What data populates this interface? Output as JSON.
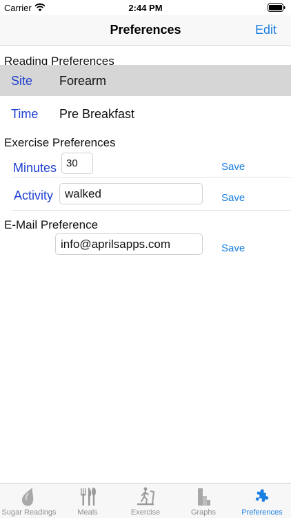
{
  "status_bar": {
    "carrier": "Carrier",
    "time": "2:44 PM",
    "wifi_icon": "wifi-icon",
    "battery_icon": "battery-icon"
  },
  "nav_bar": {
    "title": "Preferences",
    "edit_label": "Edit"
  },
  "reading_preferences": {
    "header": "Reading Preferences",
    "site_label": "Site",
    "site_value": "Forearm",
    "time_label": "Time",
    "time_value": "Pre Breakfast"
  },
  "exercise_preferences": {
    "header": "Exercise Preferences",
    "minutes_label": "Minutes",
    "minutes_value": "30",
    "minutes_save": "Save",
    "activity_label": "Activity",
    "activity_value": "walked",
    "activity_save": "Save"
  },
  "email_preference": {
    "header": "E-Mail Preference",
    "email_value": "info@aprilsapps.com",
    "email_save": "Save"
  },
  "tab_bar": {
    "items": [
      {
        "label": "Sugar Readings",
        "icon": "drop-icon",
        "active": false
      },
      {
        "label": "Meals",
        "icon": "cutlery-icon",
        "active": false
      },
      {
        "label": "Exercise",
        "icon": "treadmill-icon",
        "active": false
      },
      {
        "label": "Graphs",
        "icon": "bar-chart-icon",
        "active": false
      },
      {
        "label": "Preferences",
        "icon": "puzzle-icon",
        "active": true
      }
    ]
  },
  "colors": {
    "accent": "#1a7ee0",
    "label_blue": "#1c3fcf",
    "selected_row": "#d6d6d6",
    "tab_inactive": "#8e8e8e"
  }
}
